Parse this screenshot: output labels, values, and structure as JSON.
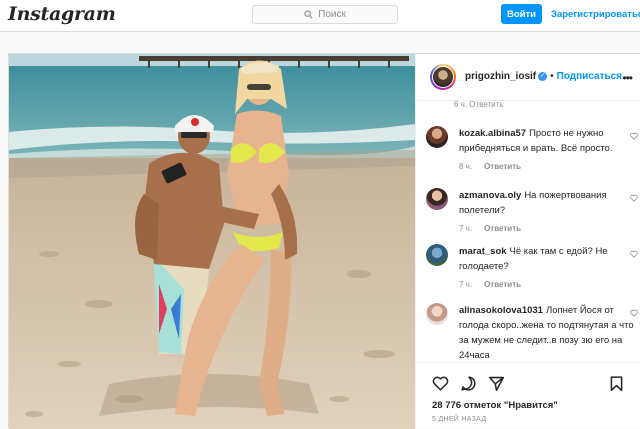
{
  "header": {
    "logo": "Instagram",
    "search_placeholder": "Поиск",
    "login_label": "Войти",
    "signup_label": "Зарегистрироваться"
  },
  "post": {
    "username": "prigozhin_iosif",
    "follow_label": "Подписаться",
    "top_meta": "6 ч.   Ответить",
    "comments": [
      {
        "username": "kozak.albina57",
        "text": "Просто не нужно прибедняться и врать. Всё просто.",
        "time": "8 ч.",
        "reply": "Ответить"
      },
      {
        "username": "azmanova.oly",
        "text": "На пожертвования полетели?",
        "time": "7 ч.",
        "reply": "Ответить"
      },
      {
        "username": "marat_sok",
        "text": "Чё как там с едой? Не голодаете?",
        "time": "7 ч.",
        "reply": "Ответить"
      },
      {
        "username": "alinasokolova1031",
        "text": "Лопнет Йося от голода скоро..жена то подтянутая а что за мужем не следит..в позу зю его на 24часа",
        "time": "",
        "reply": ""
      }
    ],
    "likes": "28 776 отметок \"Нравится\"",
    "date": "5 ДНЕЙ НАЗАД"
  },
  "icons": {
    "heart": "heart-icon",
    "comment": "comment-icon",
    "share": "share-icon",
    "bookmark": "bookmark-icon",
    "search": "search-icon",
    "verified": "verified-badge-icon",
    "more": "more-options-icon"
  },
  "colors": {
    "accent": "#0095f6",
    "text": "#262626",
    "muted": "#8e8e8e",
    "border": "#dbdbdb"
  }
}
